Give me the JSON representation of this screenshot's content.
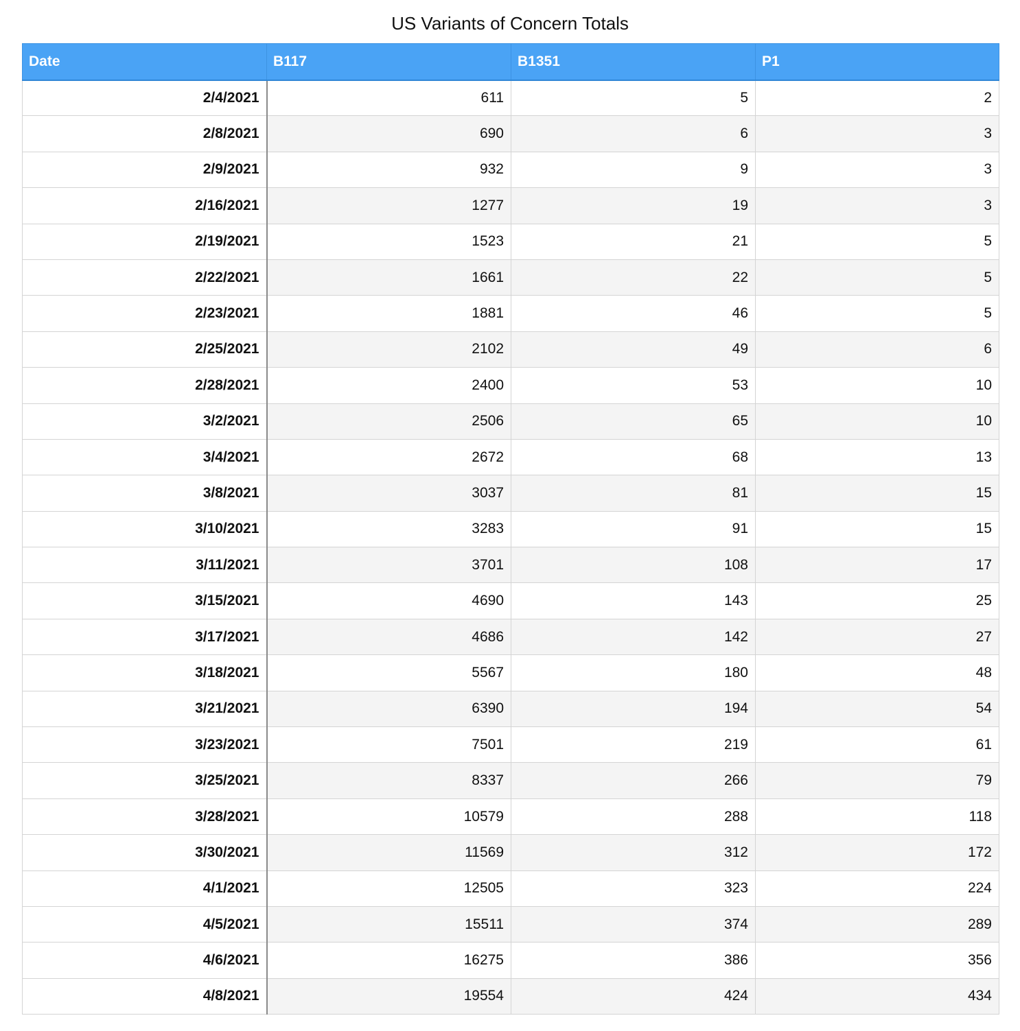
{
  "chart_data": {
    "type": "table",
    "title": "US Variants of Concern Totals",
    "columns": [
      "Date",
      "B117",
      "B1351",
      "P1"
    ],
    "rows": [
      [
        "2/4/2021",
        "611",
        "5",
        "2"
      ],
      [
        "2/8/2021",
        "690",
        "6",
        "3"
      ],
      [
        "2/9/2021",
        "932",
        "9",
        "3"
      ],
      [
        "2/16/2021",
        "1277",
        "19",
        "3"
      ],
      [
        "2/19/2021",
        "1523",
        "21",
        "5"
      ],
      [
        "2/22/2021",
        "1661",
        "22",
        "5"
      ],
      [
        "2/23/2021",
        "1881",
        "46",
        "5"
      ],
      [
        "2/25/2021",
        "2102",
        "49",
        "6"
      ],
      [
        "2/28/2021",
        "2400",
        "53",
        "10"
      ],
      [
        "3/2/2021",
        "2506",
        "65",
        "10"
      ],
      [
        "3/4/2021",
        "2672",
        "68",
        "13"
      ],
      [
        "3/8/2021",
        "3037",
        "81",
        "15"
      ],
      [
        "3/10/2021",
        "3283",
        "91",
        "15"
      ],
      [
        "3/11/2021",
        "3701",
        "108",
        "17"
      ],
      [
        "3/15/2021",
        "4690",
        "143",
        "25"
      ],
      [
        "3/17/2021",
        "4686",
        "142",
        "27"
      ],
      [
        "3/18/2021",
        "5567",
        "180",
        "48"
      ],
      [
        "3/21/2021",
        "6390",
        "194",
        "54"
      ],
      [
        "3/23/2021",
        "7501",
        "219",
        "61"
      ],
      [
        "3/25/2021",
        "8337",
        "266",
        "79"
      ],
      [
        "3/28/2021",
        "10579",
        "288",
        "118"
      ],
      [
        "3/30/2021",
        "11569",
        "312",
        "172"
      ],
      [
        "4/1/2021",
        "12505",
        "323",
        "224"
      ],
      [
        "4/5/2021",
        "15511",
        "374",
        "289"
      ],
      [
        "4/6/2021",
        "16275",
        "386",
        "356"
      ],
      [
        "4/8/2021",
        "19554",
        "424",
        "434"
      ]
    ],
    "colors": {
      "header_background": "#4aa3f5",
      "header_text": "#ffffff",
      "row_stripe": "#f4f4f4",
      "grid_line": "#d4d4d4"
    }
  }
}
